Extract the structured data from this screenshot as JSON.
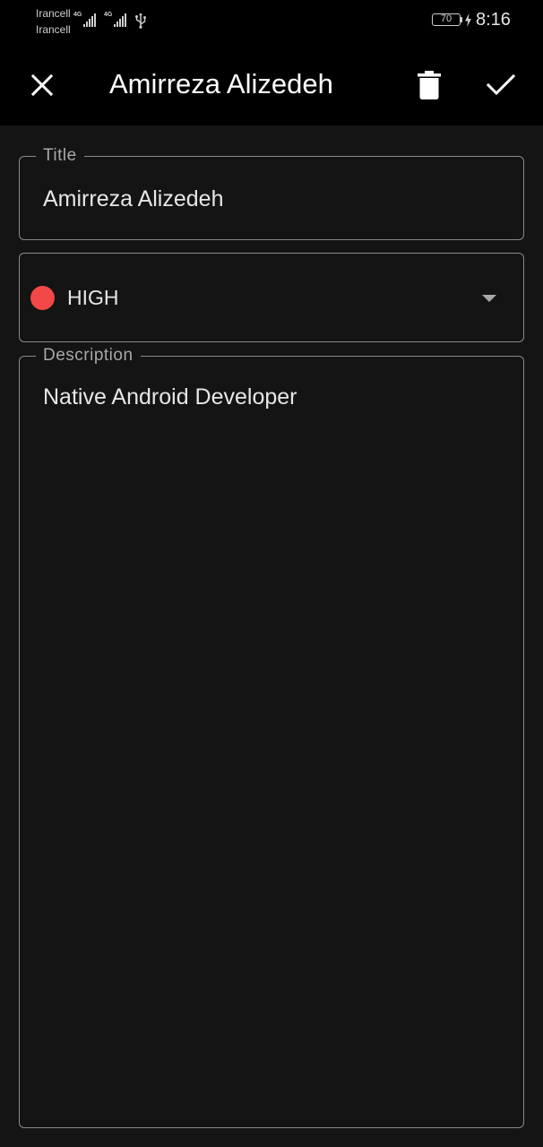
{
  "status_bar": {
    "carrier_1": "Irancell",
    "carrier_2": "Irancell",
    "network_1": "4G",
    "network_2": "4G",
    "battery_level": "70",
    "time": "8:16"
  },
  "app_bar": {
    "title": "Amirreza Alizedeh",
    "icons": [
      "close-icon",
      "delete-icon",
      "check-icon"
    ]
  },
  "form": {
    "title_field": {
      "label": "Title",
      "value": "Amirreza Alizedeh"
    },
    "priority_field": {
      "value": "HIGH",
      "indicator_color": "#f44747"
    },
    "description_field": {
      "label": "Description",
      "value": "Native Android Developer"
    }
  },
  "colors": {
    "background": "#141414",
    "app_bar": "#000000",
    "outline": "#8a8a8a",
    "priority_high": "#f44747"
  }
}
